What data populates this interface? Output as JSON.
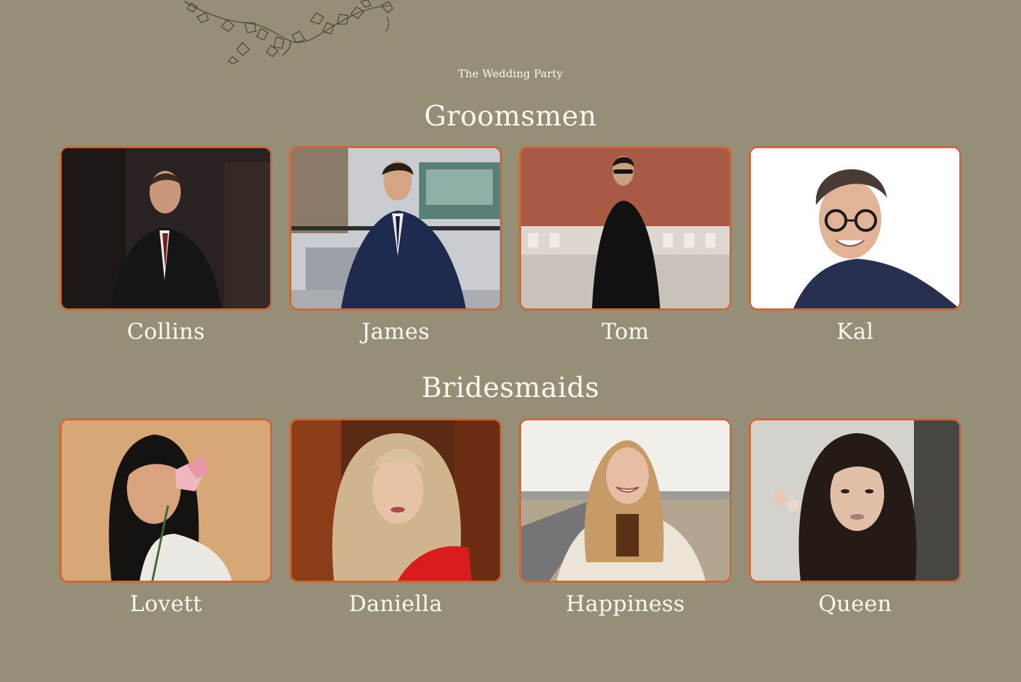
{
  "eyebrow": "The Wedding Party",
  "groomsmen": {
    "title": "Groomsmen",
    "members": [
      {
        "name": "Collins",
        "photo": "man-in-dark-suit-red-tie-photo"
      },
      {
        "name": "James",
        "photo": "man-in-navy-suit-rooftop-photo"
      },
      {
        "name": "Tom",
        "photo": "man-in-black-suit-sunglasses-photo"
      },
      {
        "name": "Kal",
        "photo": "man-with-glasses-white-background-photo"
      }
    ]
  },
  "bridesmaids": {
    "title": "Bridesmaids",
    "members": [
      {
        "name": "Lovett",
        "photo": "woman-with-pink-lily-photo"
      },
      {
        "name": "Daniella",
        "photo": "blonde-woman-red-top-photo"
      },
      {
        "name": "Happiness",
        "photo": "smiling-woman-cream-jacket-photo"
      },
      {
        "name": "Queen",
        "photo": "dark-haired-woman-portrait-photo"
      }
    ]
  },
  "colors": {
    "background": "#958f77",
    "frame": "#c8693e",
    "text": "#fbf8f1"
  }
}
